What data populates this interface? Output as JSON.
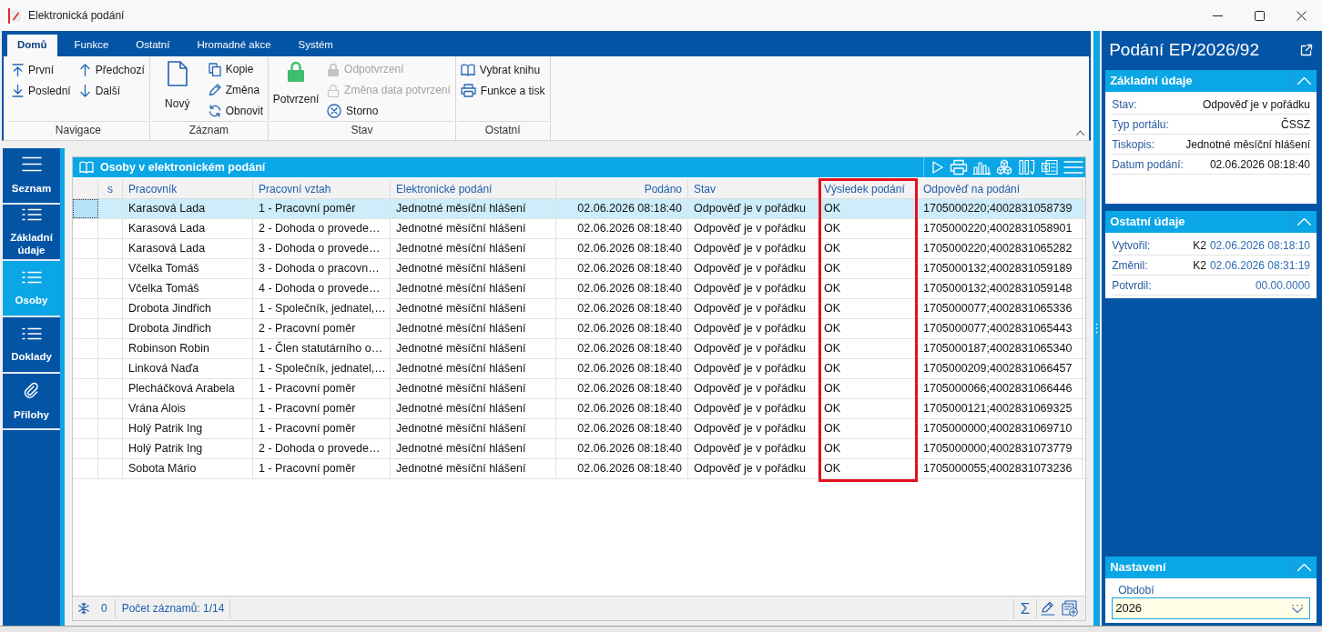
{
  "window": {
    "title": "Elektronická podání"
  },
  "ribbon": {
    "tabs": [
      {
        "label": "Domů",
        "selected": true
      },
      {
        "label": "Funkce",
        "selected": false
      },
      {
        "label": "Ostatní",
        "selected": false
      },
      {
        "label": "Hromadné akce",
        "selected": false
      },
      {
        "label": "Systém",
        "selected": false
      }
    ],
    "groups": [
      {
        "label": "Navigace",
        "columns": [
          [
            {
              "kind": "first",
              "label": "První",
              "disabled": false
            },
            {
              "kind": "last",
              "label": "Poslední",
              "disabled": false
            }
          ],
          [
            {
              "kind": "previous",
              "label": "Předchozí",
              "disabled": false
            },
            {
              "kind": "next",
              "label": "Další",
              "disabled": false
            }
          ]
        ]
      },
      {
        "label": "Záznam",
        "columns": [
          [
            {
              "kind": "new",
              "label": "Nový",
              "disabled": false
            }
          ],
          [
            {
              "kind": "copy",
              "label": "Kopie",
              "disabled": false
            },
            {
              "kind": "edit",
              "label": "Změna",
              "disabled": false
            },
            {
              "kind": "refresh",
              "label": "Obnovit",
              "disabled": false
            }
          ]
        ]
      },
      {
        "label": "Stav",
        "columns": [
          [
            {
              "kind": "confirm",
              "label": "Potvrzení",
              "disabled": false
            }
          ],
          [
            {
              "kind": "unconfirm",
              "label": "Odpotvrzení",
              "disabled": true
            },
            {
              "kind": "change_date",
              "label": "Změna data potvrzení",
              "disabled": true
            },
            {
              "kind": "cancel",
              "label": "Storno",
              "disabled": false
            }
          ]
        ]
      },
      {
        "label": "Ostatní",
        "columns": [
          [
            {
              "kind": "book",
              "label": "Vybrat knihu",
              "disabled": false
            },
            {
              "kind": "print",
              "label": "Funkce a tisk",
              "disabled": false
            }
          ]
        ]
      }
    ]
  },
  "sidebar": {
    "items": [
      {
        "kind": "menu",
        "label": "Seznam",
        "selected": false
      },
      {
        "kind": "list",
        "label": "Základní údaje",
        "selected": false
      },
      {
        "kind": "list",
        "label": "Osoby",
        "selected": true
      },
      {
        "kind": "list",
        "label": "Doklady",
        "selected": false
      },
      {
        "kind": "attachment",
        "label": "Přílohy",
        "selected": false
      }
    ]
  },
  "table": {
    "title": "Osoby v elektronickém podání",
    "columns": [
      {
        "label": "s",
        "kind": "flag",
        "highlighted": false
      },
      {
        "label": "Pracovník",
        "kind": "text",
        "highlighted": false
      },
      {
        "label": "Pracovní vztah",
        "kind": "text",
        "highlighted": false
      },
      {
        "label": "Elektronické podání",
        "kind": "text",
        "highlighted": false
      },
      {
        "label": "Podáno",
        "kind": "datetime",
        "highlighted": false
      },
      {
        "label": "Stav",
        "kind": "text",
        "highlighted": false
      },
      {
        "label": "Výsledek podání",
        "kind": "text",
        "highlighted": true
      },
      {
        "label": "Odpověď na podání",
        "kind": "text",
        "highlighted": false
      }
    ],
    "rows": [
      {
        "selected": true,
        "cells": [
          "",
          "Karasová Lada",
          "1 - Pracovní poměr",
          "Jednotné měsíční hlášení",
          "02.06.2026 08:18:40",
          "Odpověď je v pořádku",
          "OK",
          "1705000220;4002831058739"
        ]
      },
      {
        "selected": false,
        "cells": [
          "",
          "Karasová Lada",
          "2 - Dohoda o provede…",
          "Jednotné měsíční hlášení",
          "02.06.2026 08:18:40",
          "Odpověď je v pořádku",
          "OK",
          "1705000220;4002831058901"
        ]
      },
      {
        "selected": false,
        "cells": [
          "",
          "Karasová Lada",
          "3 - Dohoda o provede…",
          "Jednotné měsíční hlášení",
          "02.06.2026 08:18:40",
          "Odpověď je v pořádku",
          "OK",
          "1705000220;4002831065282"
        ]
      },
      {
        "selected": false,
        "cells": [
          "",
          "Včelka Tomáš",
          "3 - Dohoda o pracovn…",
          "Jednotné měsíční hlášení",
          "02.06.2026 08:18:40",
          "Odpověď je v pořádku",
          "OK",
          "1705000132;4002831059189"
        ]
      },
      {
        "selected": false,
        "cells": [
          "",
          "Včelka Tomáš",
          "4 - Dohoda o provede…",
          "Jednotné měsíční hlášení",
          "02.06.2026 08:18:40",
          "Odpověď je v pořádku",
          "OK",
          "1705000132;4002831059148"
        ]
      },
      {
        "selected": false,
        "cells": [
          "",
          "Drobota Jindřich",
          "1 - Společník, jednatel,…",
          "Jednotné měsíční hlášení",
          "02.06.2026 08:18:40",
          "Odpověď je v pořádku",
          "OK",
          "1705000077;4002831065336"
        ]
      },
      {
        "selected": false,
        "cells": [
          "",
          "Drobota Jindřich",
          "2 - Pracovní poměr",
          "Jednotné měsíční hlášení",
          "02.06.2026 08:18:40",
          "Odpověď je v pořádku",
          "OK",
          "1705000077;4002831065443"
        ]
      },
      {
        "selected": false,
        "cells": [
          "",
          "Robinson Robin",
          "1 - Člen statutárního o…",
          "Jednotné měsíční hlášení",
          "02.06.2026 08:18:40",
          "Odpověď je v pořádku",
          "OK",
          "1705000187;4002831065340"
        ]
      },
      {
        "selected": false,
        "cells": [
          "",
          "Linková Naďa",
          "1 - Společník, jednatel,…",
          "Jednotné měsíční hlášení",
          "02.06.2026 08:18:40",
          "Odpověď je v pořádku",
          "OK",
          "1705000209;4002831066457"
        ]
      },
      {
        "selected": false,
        "cells": [
          "",
          "Plecháčková Arabela",
          "1 - Pracovní poměr",
          "Jednotné měsíční hlášení",
          "02.06.2026 08:18:40",
          "Odpověď je v pořádku",
          "OK",
          "1705000066;4002831066446"
        ]
      },
      {
        "selected": false,
        "cells": [
          "",
          "Vrána Alois",
          "1 - Pracovní poměr",
          "Jednotné měsíční hlášení",
          "02.06.2026 08:18:40",
          "Odpověď je v pořádku",
          "OK",
          "1705000121;4002831069325"
        ]
      },
      {
        "selected": false,
        "cells": [
          "",
          "Holý Patrik Ing",
          "1 - Pracovní poměr",
          "Jednotné měsíční hlášení",
          "02.06.2026 08:18:40",
          "Odpověď je v pořádku",
          "OK",
          "1705000000;4002831069710"
        ]
      },
      {
        "selected": false,
        "cells": [
          "",
          "Holý Patrik Ing",
          "2 - Dohoda o provede…",
          "Jednotné měsíční hlášení",
          "02.06.2026 08:18:40",
          "Odpověď je v pořádku",
          "OK",
          "1705000000;4002831073779"
        ]
      },
      {
        "selected": false,
        "cells": [
          "",
          "Sobota Mário",
          "1 - Pracovní poměr",
          "Jednotné měsíční hlášení",
          "02.06.2026 08:18:40",
          "Odpověď je v pořádku",
          "OK",
          "1705000055;4002831073236"
        ]
      }
    ],
    "status_bar": {
      "filter_count": "0",
      "record_count": "Počet záznamů: 1/14",
      "sum_symbol": "Σ"
    }
  },
  "detail_panel": {
    "title": "Podání EP/2026/92",
    "sections": [
      {
        "title": "Základní údaje",
        "expanded": true,
        "fields": [
          {
            "kind": "text",
            "label": "Stav:",
            "value": "Odpověď je v pořádku"
          },
          {
            "kind": "text",
            "label": "Typ portálu:",
            "value": "ČSSZ"
          },
          {
            "kind": "text",
            "label": "Tiskopis:",
            "value": "Jednotné měsíční hlášení"
          },
          {
            "kind": "text",
            "label": "Datum podání:",
            "value": "02.06.2026 08:18:40"
          }
        ]
      },
      {
        "title": "Ostatní údaje",
        "expanded": true,
        "fields": [
          {
            "kind": "stamp",
            "label": "Vytvořil:",
            "user": "K2",
            "value": "02.06.2026 08:18:10"
          },
          {
            "kind": "stamp",
            "label": "Změnil:",
            "user": "K2",
            "value": "02.06.2026 08:31:19"
          },
          {
            "kind": "stamp",
            "label": "Potvrdil:",
            "value": "00.00.0000"
          }
        ]
      }
    ],
    "settings": {
      "title": "Nastavení",
      "expanded": true,
      "field": {
        "label": "Období",
        "value": "2026"
      }
    }
  }
}
